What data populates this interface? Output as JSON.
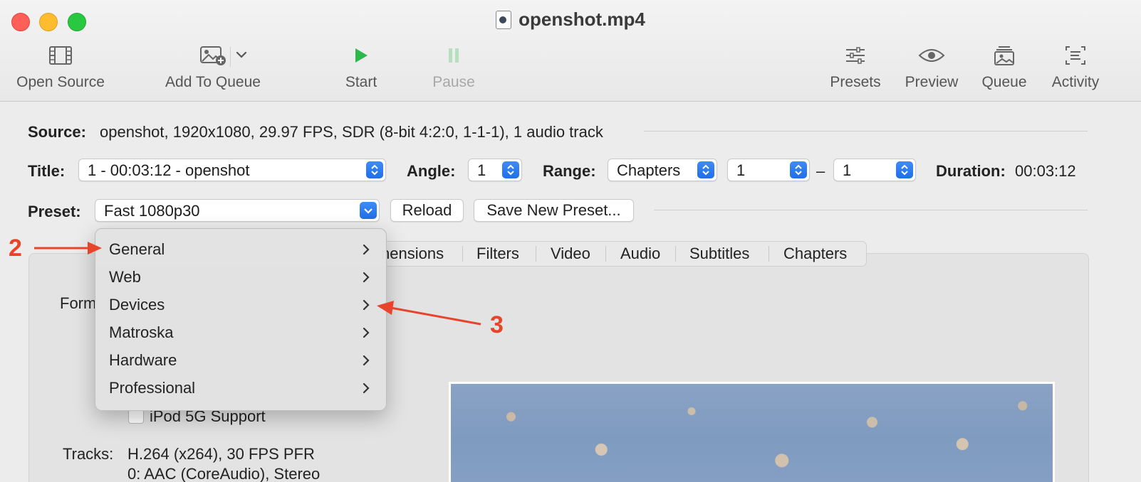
{
  "window": {
    "title": "openshot.mp4"
  },
  "toolbar": {
    "open_source": "Open Source",
    "add_to_queue": "Add To Queue",
    "start": "Start",
    "pause": "Pause",
    "presets": "Presets",
    "preview": "Preview",
    "queue": "Queue",
    "activity": "Activity"
  },
  "source": {
    "label": "Source:",
    "value": "openshot, 1920x1080, 29.97 FPS, SDR (8-bit 4:2:0, 1-1-1), 1 audio track"
  },
  "title_row": {
    "title_label": "Title:",
    "title_value": "1 - 00:03:12 - openshot",
    "angle_label": "Angle:",
    "angle_value": "1",
    "range_label": "Range:",
    "range_type": "Chapters",
    "range_start": "1",
    "range_dash": "–",
    "range_end": "1",
    "duration_label": "Duration:",
    "duration_value": "00:03:12"
  },
  "preset_row": {
    "label": "Preset:",
    "value": "Fast 1080p30",
    "reload": "Reload",
    "save_new": "Save New Preset..."
  },
  "tabs": [
    "nensions",
    "Filters",
    "Video",
    "Audio",
    "Subtitles",
    "Chapters"
  ],
  "summary": {
    "format_label": "Form",
    "ipod_label": "iPod 5G Support",
    "tracks_label": "Tracks:",
    "tracks_line1": "H.264 (x264), 30 FPS PFR",
    "tracks_line2": "0: AAC (CoreAudio), Stereo"
  },
  "menu": {
    "items": [
      "General",
      "Web",
      "Devices",
      "Matroska",
      "Hardware",
      "Professional"
    ]
  },
  "annotations": {
    "label_2": "2",
    "label_3": "3",
    "color": "#e8442c"
  },
  "colors": {
    "accent": "#2a76ea",
    "close": "#ff5f57",
    "minimize": "#febc2e",
    "zoom": "#28c840",
    "start": "#2db84a"
  }
}
